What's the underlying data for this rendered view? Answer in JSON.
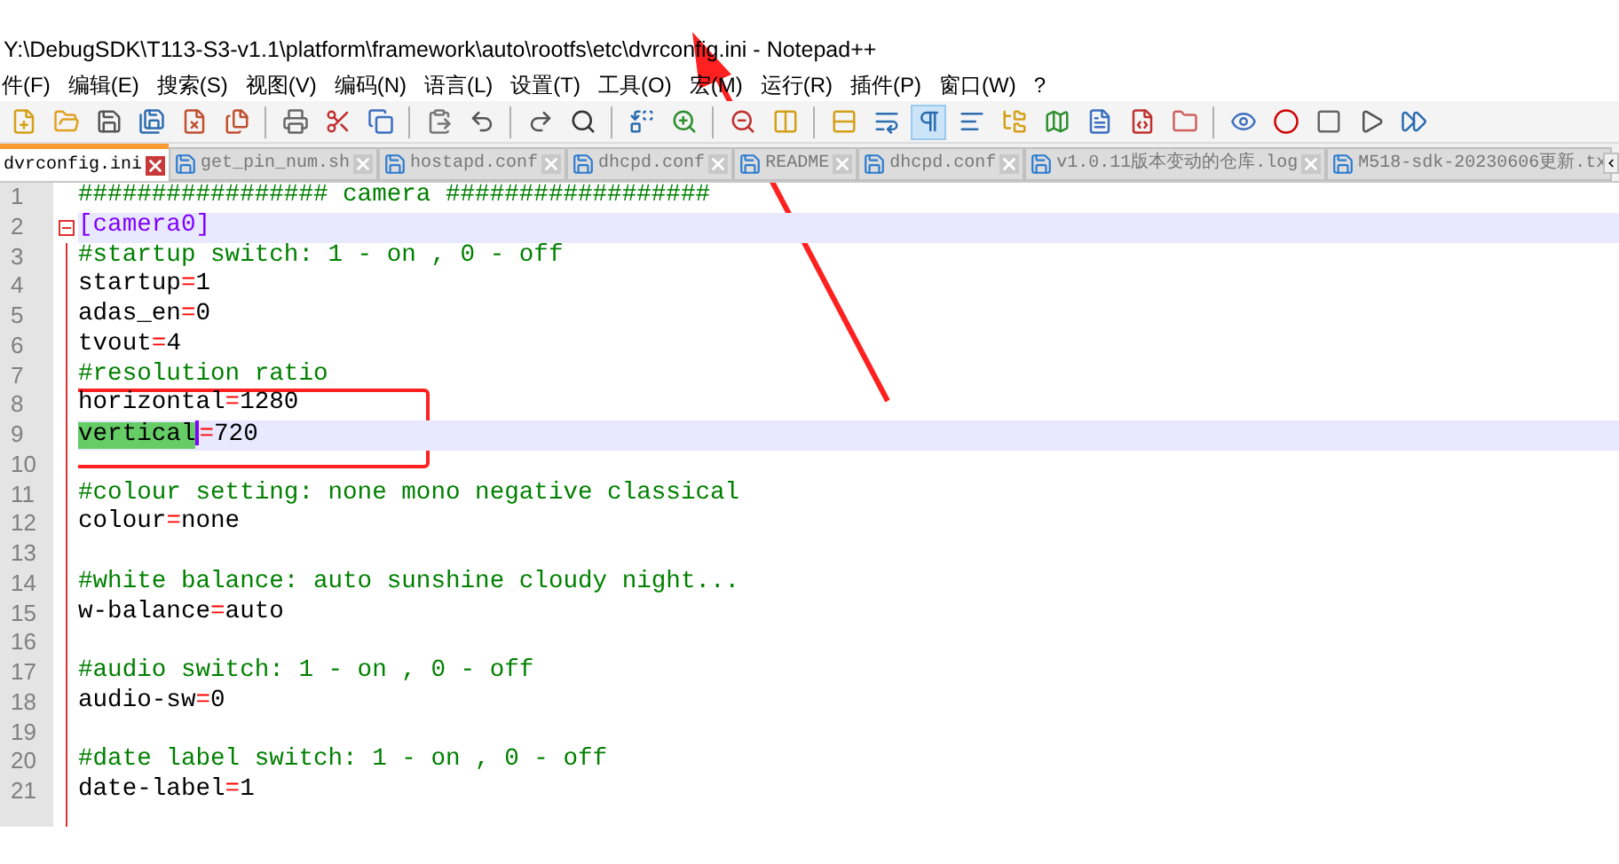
{
  "window": {
    "title": "Y:\\DebugSDK\\T113-S3-v1.1\\platform\\framework\\auto\\rootfs\\etc\\dvrconfig.ini - Notepad++"
  },
  "menu": [
    "件(F)",
    "编辑(E)",
    "搜索(S)",
    "视图(V)",
    "编码(N)",
    "语言(L)",
    "设置(T)",
    "工具(O)",
    "宏(M)",
    "运行(R)",
    "插件(P)",
    "窗口(W)",
    "?"
  ],
  "toolbar": [
    {
      "kind": "button",
      "pressed": false
    },
    {
      "kind": "button",
      "pressed": false
    },
    {
      "kind": "button",
      "pressed": false
    },
    {
      "kind": "button",
      "pressed": false
    },
    {
      "kind": "button",
      "pressed": false
    },
    {
      "kind": "button",
      "pressed": false
    },
    {
      "kind": "separator"
    },
    {
      "kind": "button",
      "pressed": false
    },
    {
      "kind": "button",
      "pressed": false
    },
    {
      "kind": "button",
      "pressed": false
    },
    {
      "kind": "separator"
    },
    {
      "kind": "button",
      "pressed": false
    },
    {
      "kind": "button",
      "pressed": false
    },
    {
      "kind": "separator"
    },
    {
      "kind": "button",
      "pressed": false
    },
    {
      "kind": "button",
      "pressed": false
    },
    {
      "kind": "separator"
    },
    {
      "kind": "button",
      "pressed": false
    },
    {
      "kind": "button",
      "pressed": false
    },
    {
      "kind": "separator"
    },
    {
      "kind": "button",
      "pressed": false
    },
    {
      "kind": "button",
      "pressed": false
    },
    {
      "kind": "separator"
    },
    {
      "kind": "button",
      "pressed": false
    },
    {
      "kind": "button",
      "pressed": false
    },
    {
      "kind": "button",
      "pressed": true
    },
    {
      "kind": "button",
      "pressed": false
    },
    {
      "kind": "button",
      "pressed": false
    },
    {
      "kind": "button",
      "pressed": false
    },
    {
      "kind": "button",
      "pressed": false
    },
    {
      "kind": "button",
      "pressed": false
    },
    {
      "kind": "button",
      "pressed": false
    },
    {
      "kind": "separator"
    },
    {
      "kind": "button",
      "pressed": false
    },
    {
      "kind": "button",
      "pressed": false
    },
    {
      "kind": "button",
      "pressed": false
    },
    {
      "kind": "button",
      "pressed": false
    },
    {
      "kind": "button",
      "pressed": false
    }
  ],
  "tabs": [
    {
      "label": "dvrconfig.ini",
      "selected": true
    },
    {
      "label": "get_pin_num.sh",
      "selected": false
    },
    {
      "label": "hostapd.conf",
      "selected": false
    },
    {
      "label": "dhcpd.conf",
      "selected": false
    },
    {
      "label": "README",
      "selected": false
    },
    {
      "label": "dhcpd.conf",
      "selected": false
    },
    {
      "label": "v1.0.11版本变动的仓库.log",
      "selected": false
    },
    {
      "label": "M518-sdk-20230606更新.tx",
      "selected": false
    }
  ],
  "editor": {
    "lines": [
      {
        "number": "1",
        "kind": "comment",
        "text": "################# camera ##################",
        "highlighted": false
      },
      {
        "number": "2",
        "kind": "section",
        "text": "[camera0]",
        "highlighted": true,
        "fold": true
      },
      {
        "number": "3",
        "kind": "comment",
        "text": "#startup switch: 1 - on , 0 - off",
        "highlighted": false
      },
      {
        "number": "4",
        "kind": "keyvalue",
        "key": "startup",
        "sep": "=",
        "value": "1",
        "highlighted": false
      },
      {
        "number": "5",
        "kind": "keyvalue",
        "key": "adas_en",
        "sep": "=",
        "value": "0",
        "highlighted": false
      },
      {
        "number": "6",
        "kind": "keyvalue",
        "key": "tvout",
        "sep": "=",
        "value": "4",
        "highlighted": false
      },
      {
        "number": "7",
        "kind": "comment",
        "text": "#resolution ratio",
        "highlighted": false
      },
      {
        "number": "8",
        "kind": "keyvalue",
        "key": "horizontal",
        "sep": "=",
        "value": "1280",
        "highlighted": false
      },
      {
        "number": "9",
        "kind": "keyvalue",
        "key": "vertical",
        "sep": "=",
        "value": "720",
        "highlighted": true,
        "key_selected": true
      },
      {
        "number": "10",
        "kind": "blank",
        "highlighted": false
      },
      {
        "number": "11",
        "kind": "comment",
        "text": "#colour setting: none mono negative classical",
        "highlighted": false
      },
      {
        "number": "12",
        "kind": "keyvalue",
        "key": "colour",
        "sep": "=",
        "value": "none",
        "highlighted": false
      },
      {
        "number": "13",
        "kind": "blank",
        "highlighted": false
      },
      {
        "number": "14",
        "kind": "comment",
        "text": "#white balance: auto sunshine cloudy night...",
        "highlighted": false
      },
      {
        "number": "15",
        "kind": "keyvalue",
        "key": "w-balance",
        "sep": "=",
        "value": "auto",
        "highlighted": false
      },
      {
        "number": "16",
        "kind": "blank",
        "highlighted": false
      },
      {
        "number": "17",
        "kind": "comment",
        "text": "#audio switch: 1 - on , 0 - off",
        "highlighted": false
      },
      {
        "number": "18",
        "kind": "keyvalue",
        "key": "audio-sw",
        "sep": "=",
        "value": "0",
        "highlighted": false
      },
      {
        "number": "19",
        "kind": "blank",
        "highlighted": false
      },
      {
        "number": "20",
        "kind": "comment",
        "text": "#date label switch: 1 - on , 0 - off",
        "highlighted": false
      },
      {
        "number": "21",
        "kind": "keyvalue",
        "key": "date-label",
        "sep": "=",
        "value": "1",
        "highlighted": false
      }
    ]
  }
}
